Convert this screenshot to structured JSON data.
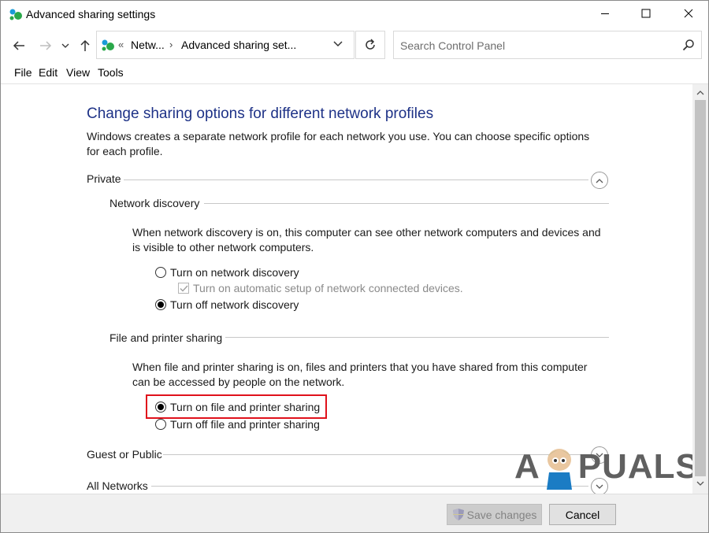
{
  "window": {
    "title": "Advanced sharing settings"
  },
  "address_bar": {
    "overflow_chevron": "«",
    "crumbs": [
      "Netw...",
      "Advanced sharing set..."
    ],
    "separator": "›"
  },
  "search": {
    "placeholder": "Search Control Panel"
  },
  "menu": {
    "items": [
      "File",
      "Edit",
      "View",
      "Tools"
    ]
  },
  "content": {
    "heading": "Change sharing options for different network profiles",
    "intro": "Windows creates a separate network profile for each network you use. You can choose specific options for each profile.",
    "private": {
      "label": "Private",
      "network_discovery": {
        "label": "Network discovery",
        "description": "When network discovery is on, this computer can see other network computers and devices and is visible to other network computers.",
        "options": [
          {
            "label": "Turn on network discovery",
            "selected": false
          },
          {
            "label": "Turn off network discovery",
            "selected": true
          }
        ],
        "auto_setup": {
          "label": "Turn on automatic setup of network connected devices.",
          "checked": true,
          "disabled": true
        }
      },
      "file_printer_sharing": {
        "label": "File and printer sharing",
        "description": "When file and printer sharing is on, files and printers that you have shared from this computer can be accessed by people on the network.",
        "options": [
          {
            "label": "Turn on file and printer sharing",
            "selected": true
          },
          {
            "label": "Turn off file and printer sharing",
            "selected": false
          }
        ]
      }
    },
    "guest_public": {
      "label": "Guest or Public"
    },
    "all_networks": {
      "label": "All Networks"
    }
  },
  "footer": {
    "save_label": "Save changes",
    "cancel_label": "Cancel"
  },
  "watermark": {
    "letters_left": "A",
    "letters_right": "PUALS"
  },
  "colors": {
    "heading": "#1e3287",
    "highlight": "#e0111b",
    "scroll_thumb": "#c2c2c2"
  }
}
